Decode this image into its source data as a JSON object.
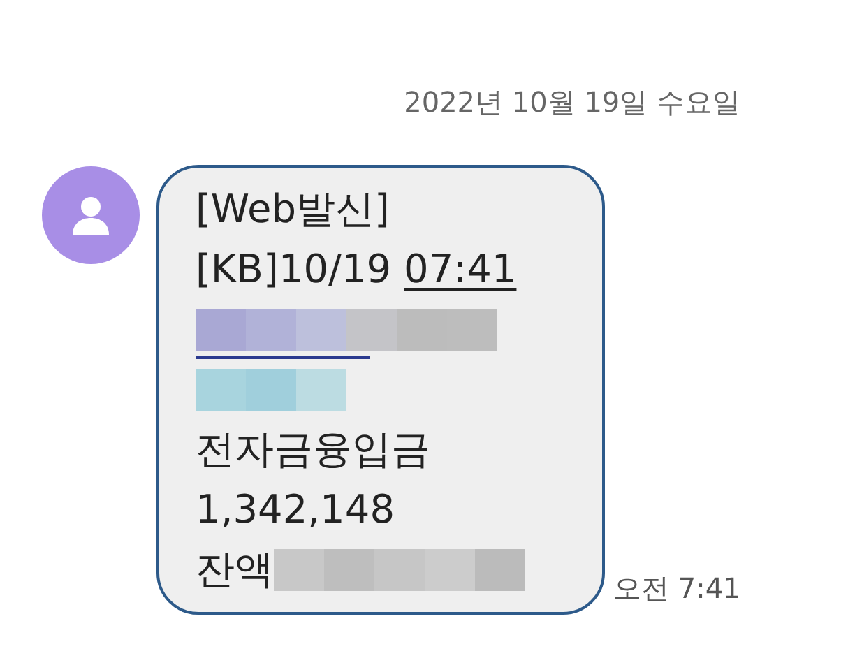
{
  "date_header": "2022년 10월 19일 수요일",
  "message": {
    "lines": [
      {
        "segments": [
          {
            "kind": "text",
            "text": "[Web발신]",
            "link": false
          }
        ]
      },
      {
        "segments": [
          {
            "kind": "text",
            "text": "[KB]10/19 ",
            "link": false
          },
          {
            "kind": "text",
            "text": "07:41",
            "link": true
          }
        ]
      },
      {
        "segments": [
          {
            "kind": "redacted",
            "link": true
          }
        ]
      },
      {
        "segments": [
          {
            "kind": "redacted",
            "link": false
          }
        ]
      },
      {
        "segments": [
          {
            "kind": "text",
            "text": "전자금융입금",
            "link": false
          }
        ]
      },
      {
        "segments": [
          {
            "kind": "text",
            "text": "1,342,148",
            "link": false
          }
        ]
      },
      {
        "segments": [
          {
            "kind": "text",
            "text": "잔액",
            "link": false
          },
          {
            "kind": "redacted",
            "link": false
          }
        ]
      }
    ],
    "time": "오전 7:41"
  }
}
